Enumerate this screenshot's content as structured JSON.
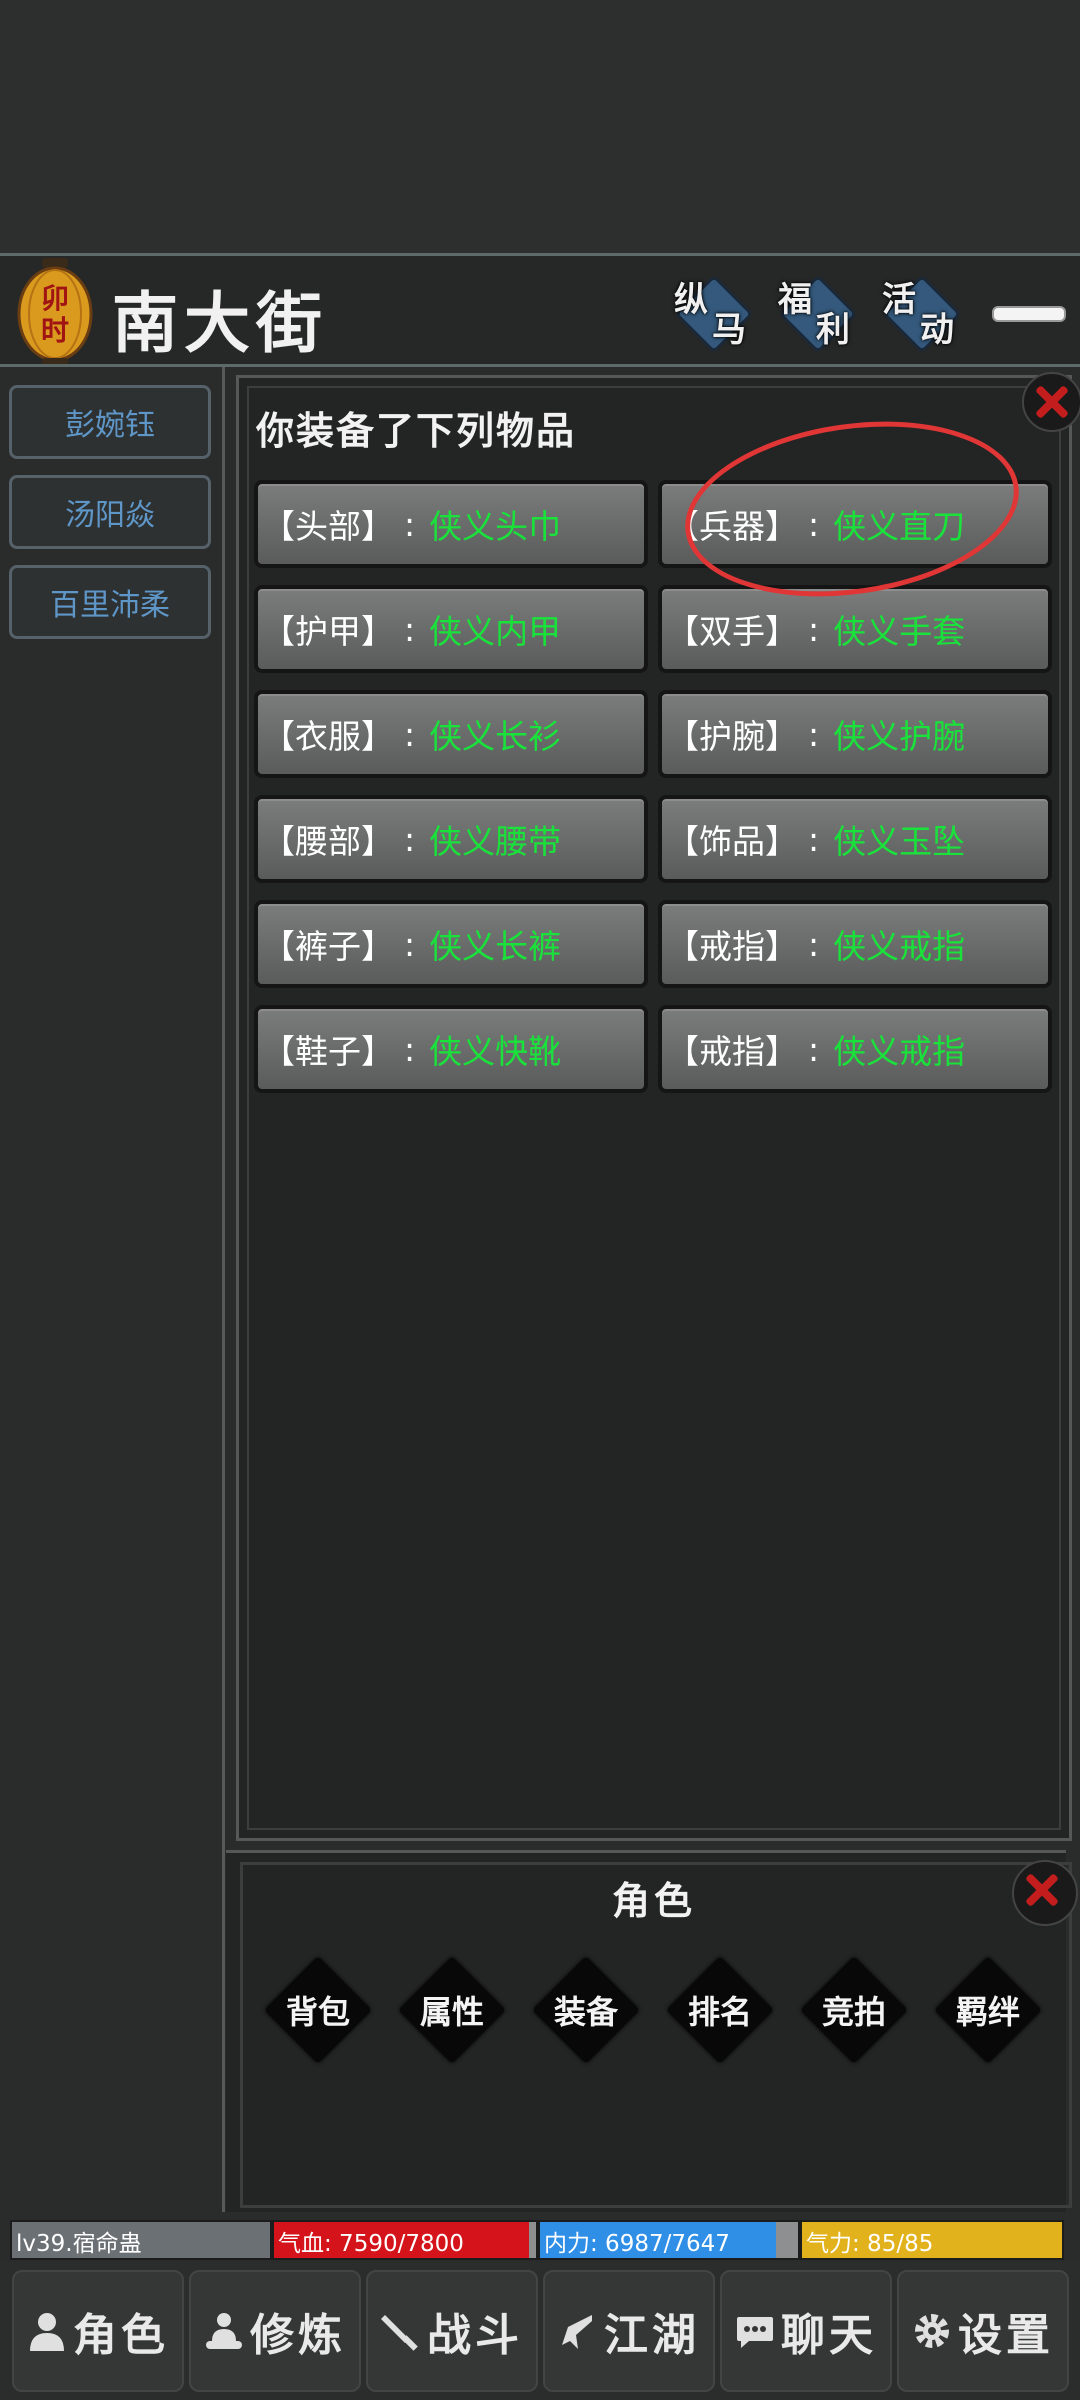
{
  "header": {
    "time_badge": "卯时",
    "location": "南大街",
    "buttons": [
      {
        "t1": "纵",
        "t2": "马"
      },
      {
        "t1": "福",
        "t2": "利"
      },
      {
        "t1": "活",
        "t2": "动"
      }
    ]
  },
  "sidebar": {
    "players": [
      "彭婉钰",
      "汤阳焱",
      "百里沛柔"
    ]
  },
  "equipment_panel": {
    "title": "你装备了下列物品",
    "slots": [
      {
        "label": "【头部】",
        "sep": ":",
        "item": "侠义头巾"
      },
      {
        "label": "【兵器】",
        "sep": ":",
        "item": "侠义直刀"
      },
      {
        "label": "【护甲】",
        "sep": ":",
        "item": "侠义内甲"
      },
      {
        "label": "【双手】",
        "sep": ":",
        "item": "侠义手套"
      },
      {
        "label": "【衣服】",
        "sep": ":",
        "item": "侠义长衫"
      },
      {
        "label": "【护腕】",
        "sep": ":",
        "item": "侠义护腕"
      },
      {
        "label": "【腰部】",
        "sep": ":",
        "item": "侠义腰带"
      },
      {
        "label": "【饰品】",
        "sep": ":",
        "item": "侠义玉坠"
      },
      {
        "label": "【裤子】",
        "sep": ":",
        "item": "侠义长裤"
      },
      {
        "label": "【戒指】",
        "sep": ":",
        "item": "侠义戒指"
      },
      {
        "label": "【鞋子】",
        "sep": ":",
        "item": "侠义快靴"
      },
      {
        "label": "【戒指】",
        "sep": ":",
        "item": "侠义戒指"
      }
    ]
  },
  "role_panel": {
    "title": "角色",
    "buttons": [
      "背包",
      "属性",
      "装备",
      "排名",
      "竞拍",
      "羁绊"
    ]
  },
  "status": {
    "level": {
      "text": "lv39.宿命蛊",
      "color": "#6b7074"
    },
    "hp": {
      "text": "气血: 7590/7800",
      "fraction": 0.973,
      "color": "#d4141a"
    },
    "mp": {
      "text": "内力: 6987/7647",
      "fraction": 0.914,
      "color": "#2f8ee6"
    },
    "stamina": {
      "text": "气力: 85/85",
      "fraction": 1.0,
      "color": "#e2b21c"
    }
  },
  "nav": {
    "items": [
      {
        "label": "角色",
        "icon": "person-icon"
      },
      {
        "label": "修炼",
        "icon": "meditate-icon"
      },
      {
        "label": "战斗",
        "icon": "sword-icon"
      },
      {
        "label": "江湖",
        "icon": "boot-icon"
      },
      {
        "label": "聊天",
        "icon": "chat-icon"
      },
      {
        "label": "设置",
        "icon": "gear-icon"
      }
    ]
  }
}
